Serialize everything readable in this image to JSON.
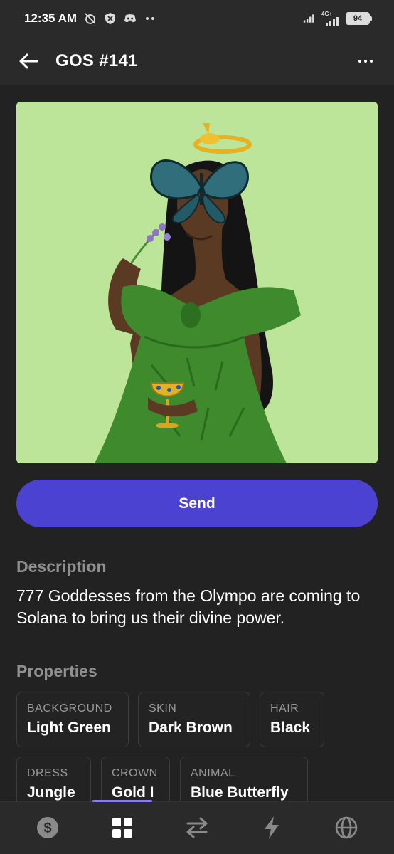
{
  "status_bar": {
    "time": "12:35 AM",
    "icons_left": [
      "alarm-off-icon",
      "shield-icon",
      "discord-icon",
      "more-dots-icon"
    ],
    "network": "4G+",
    "battery": "94"
  },
  "header": {
    "title": "GOS #141",
    "back_icon": "back-arrow-icon",
    "more_icon": "more-horizontal-icon"
  },
  "nft": {
    "image_name": "goddess-nft-image",
    "background_color": "#bde59a"
  },
  "actions": {
    "send_label": "Send",
    "accent_color": "#4b42d1"
  },
  "description": {
    "heading": "Description",
    "text": "777 Goddesses from the Olympo are coming to Solana to bring us their divine power."
  },
  "properties": {
    "heading": "Properties",
    "items": [
      {
        "label": "BACKGROUND",
        "value": "Light Green"
      },
      {
        "label": "SKIN",
        "value": "Dark Brown"
      },
      {
        "label": "HAIR",
        "value": "Black"
      },
      {
        "label": "DRESS",
        "value": "Jungle"
      },
      {
        "label": "CROWN",
        "value": "Gold I"
      },
      {
        "label": "ANIMAL",
        "value": "Blue Butterfly"
      }
    ]
  },
  "bottom_nav": {
    "items": [
      "dollar-icon",
      "grid-icon",
      "swap-icon",
      "lightning-icon",
      "globe-icon"
    ],
    "active": "grid-icon",
    "indicator_color": "#8b7ff0"
  }
}
